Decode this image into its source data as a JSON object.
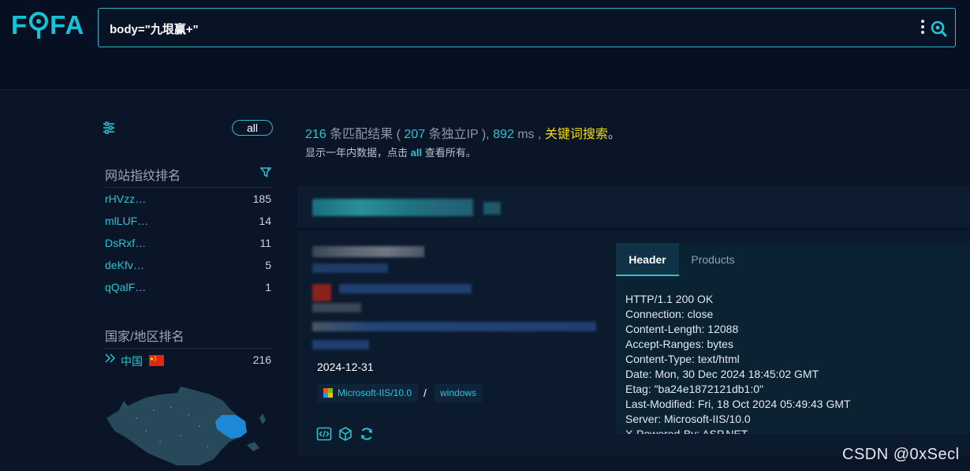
{
  "app": {
    "logo_text": "FOFA",
    "search_query": "body=\"九垠赢+\"",
    "colors": {
      "accent": "#27c5d4",
      "keyword": "#f7dd12",
      "bg": "#071325"
    }
  },
  "sidebar": {
    "all_label": "all",
    "fingerprint_title": "网站指纹排名",
    "fingerprint_ranks": [
      {
        "name": "rHVzz…",
        "count": "185"
      },
      {
        "name": "mlLUF…",
        "count": "14"
      },
      {
        "name": "DsRxf…",
        "count": "11"
      },
      {
        "name": "deKfv…",
        "count": "5"
      },
      {
        "name": "qQalF…",
        "count": "1"
      }
    ],
    "country_title": "国家/地区排名",
    "country_ranks": [
      {
        "name": "中国",
        "count": "216",
        "flag": "cn-flag"
      }
    ]
  },
  "results": {
    "count": "216",
    "count_suffix": "条匹配结果 (",
    "ip_count": "207",
    "ip_suffix": "条独立IP ),",
    "time": "892",
    "time_unit": "ms ,",
    "keyword_link": "关键词搜索",
    "keyword_after": "。",
    "note_prefix": "显示一年内数据，点击",
    "note_link": "all",
    "note_suffix": "查看所有。"
  },
  "card": {
    "date": "2024-12-31",
    "tags": [
      "Microsoft-IIS/10.0",
      "windows"
    ],
    "tag_separator": "/",
    "action_icons": [
      "code-icon",
      "cube-icon",
      "refresh-icon"
    ],
    "tabs": [
      "Header",
      "Products"
    ],
    "active_tab": "Header",
    "header_text": "HTTP/1.1 200 OK\nConnection: close\nContent-Length: 12088\nAccept-Ranges: bytes\nContent-Type: text/html\nDate: Mon, 30 Dec 2024 18:45:02 GMT\nEtag: \"ba24e1872121db1:0\"\nLast-Modified: Fri, 18 Oct 2024 05:49:43 GMT\nServer: Microsoft-IIS/10.0\nX-Powered-By: ASP.NET"
  },
  "watermark": "CSDN @0xSecl"
}
